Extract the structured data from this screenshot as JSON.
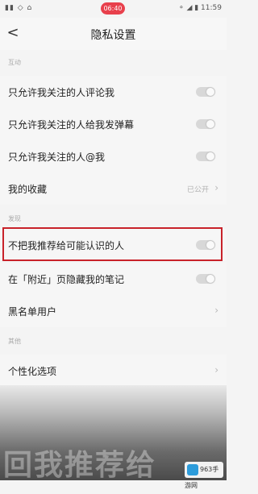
{
  "status_bar": {
    "left": "▮▮ ◇ ⌂",
    "pill": "06:40",
    "right": "⚬ ◢ ▮ 11:59"
  },
  "header": {
    "back": "<",
    "title": "隐私设置"
  },
  "sections": {
    "comments": "互动",
    "recommend": "发现",
    "personal": "其他"
  },
  "rows": [
    {
      "label": "只允许我关注的人评论我",
      "control": "toggle",
      "value": ""
    },
    {
      "label": "只允许我关注的人给我发弹幕",
      "control": "toggle",
      "value": ""
    },
    {
      "label": "只允许我关注的人@我",
      "control": "toggle",
      "value": ""
    },
    {
      "label": "我的收藏",
      "control": "chevron",
      "value": "已公开"
    },
    {
      "label": "不把我推荐给可能认识的人",
      "control": "toggle",
      "value": ""
    },
    {
      "label": "在「附近」页隐藏我的笔记",
      "control": "toggle",
      "value": ""
    },
    {
      "label": "黑名单用户",
      "control": "chevron",
      "value": ""
    },
    {
      "label": "个性化选项",
      "control": "chevron",
      "value": ""
    }
  ],
  "chevron": "›",
  "bottom_text": "回我推荐给",
  "watermark": "963手游网"
}
